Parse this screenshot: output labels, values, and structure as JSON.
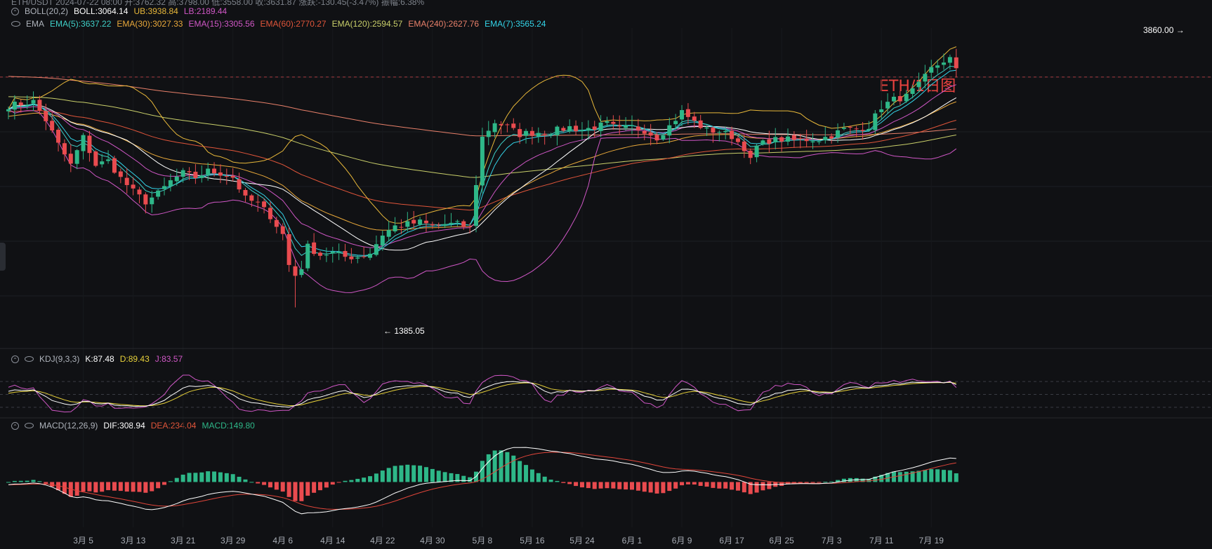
{
  "header_truncated": "ETH/USDT  2024-07-22 08:00  开:3762.32  高:3798.00  低:3558.00  收:3631.87  涨跌:-130.45(-3.47%)  振幅:6.38%",
  "legends": {
    "boll": {
      "name": "BOLL(20,2)",
      "mid": "BOLL:3064.14",
      "ub": "UB:3938.84",
      "lb": "LB:2189.44"
    },
    "ema": {
      "name": "EMA",
      "items": [
        {
          "label": "EMA(5):3637.22",
          "color": "#3fd0c8"
        },
        {
          "label": "EMA(30):3027.33",
          "color": "#e8a83a"
        },
        {
          "label": "EMA(15):3305.56",
          "color": "#d057c6"
        },
        {
          "label": "EMA(60):2770.27",
          "color": "#e0553a"
        },
        {
          "label": "EMA(120):2594.57",
          "color": "#c9cf6a"
        },
        {
          "label": "EMA(240):2627.76",
          "color": "#e8806a"
        },
        {
          "label": "EMA(7):3565.24",
          "color": "#33d4e8"
        }
      ]
    },
    "kdj": {
      "name": "KDJ(9,3,3)",
      "k": "K:87.48",
      "d": "D:89.43",
      "j": "J:83.57"
    },
    "macd": {
      "name": "MACD(12,26,9)",
      "dif": "DIF:308.94",
      "dea": "DEA:234.04",
      "macd": "MACD:149.80"
    }
  },
  "chart_title": "ETH/1日图",
  "high_label": "3860.00",
  "low_label": "1385.05",
  "colors": {
    "up": "#2eb788",
    "down": "#e94b4f",
    "bg": "#101114"
  },
  "chart_data": {
    "type": "candlestick",
    "price_range": [
      1100,
      4120
    ],
    "x_ticks": [
      {
        "label": "3月 5",
        "index": 12
      },
      {
        "label": "3月 13",
        "index": 20
      },
      {
        "label": "3月 21",
        "index": 28
      },
      {
        "label": "3月 29",
        "index": 36
      },
      {
        "label": "4月 6",
        "index": 44
      },
      {
        "label": "4月 14",
        "index": 52
      },
      {
        "label": "4月 22",
        "index": 60
      },
      {
        "label": "4月 30",
        "index": 68
      },
      {
        "label": "5月 8",
        "index": 76
      },
      {
        "label": "5月 16",
        "index": 84
      },
      {
        "label": "5月 24",
        "index": 92
      },
      {
        "label": "6月 1",
        "index": 100
      },
      {
        "label": "6月 9",
        "index": 108
      },
      {
        "label": "6月 17",
        "index": 116
      },
      {
        "label": "6月 25",
        "index": 124
      },
      {
        "label": "7月 3",
        "index": 132
      },
      {
        "label": "7月 11",
        "index": 140
      },
      {
        "label": "7月 19",
        "index": 148
      }
    ],
    "anchors": [
      [
        0,
        3360
      ],
      [
        4,
        3400
      ],
      [
        6,
        3220
      ],
      [
        8,
        2980
      ],
      [
        10,
        2780
      ],
      [
        12,
        3050
      ],
      [
        14,
        2780
      ],
      [
        16,
        2820
      ],
      [
        18,
        2650
      ],
      [
        20,
        2520
      ],
      [
        22,
        2420
      ],
      [
        24,
        2500
      ],
      [
        26,
        2620
      ],
      [
        28,
        2700
      ],
      [
        30,
        2660
      ],
      [
        32,
        2720
      ],
      [
        34,
        2700
      ],
      [
        36,
        2660
      ],
      [
        38,
        2450
      ],
      [
        40,
        2400
      ],
      [
        42,
        2280
      ],
      [
        44,
        2100
      ],
      [
        45,
        1800
      ],
      [
        46,
        1700
      ],
      [
        47,
        1780
      ],
      [
        48,
        1980
      ],
      [
        50,
        1900
      ],
      [
        52,
        1920
      ],
      [
        54,
        1880
      ],
      [
        56,
        1880
      ],
      [
        58,
        1920
      ],
      [
        60,
        2100
      ],
      [
        62,
        2180
      ],
      [
        64,
        2200
      ],
      [
        66,
        2220
      ],
      [
        68,
        2180
      ],
      [
        70,
        2200
      ],
      [
        72,
        2200
      ],
      [
        74,
        2160
      ],
      [
        75,
        2600
      ],
      [
        76,
        3050
      ],
      [
        78,
        3200
      ],
      [
        80,
        3150
      ],
      [
        82,
        3080
      ],
      [
        84,
        3100
      ],
      [
        86,
        3100
      ],
      [
        88,
        3120
      ],
      [
        90,
        3150
      ],
      [
        92,
        3120
      ],
      [
        94,
        3150
      ],
      [
        96,
        3180
      ],
      [
        98,
        3130
      ],
      [
        100,
        3150
      ],
      [
        102,
        3120
      ],
      [
        104,
        3050
      ],
      [
        106,
        3160
      ],
      [
        108,
        3300
      ],
      [
        110,
        3200
      ],
      [
        112,
        3120
      ],
      [
        114,
        3110
      ],
      [
        116,
        3060
      ],
      [
        118,
        2950
      ],
      [
        119,
        2820
      ],
      [
        120,
        2960
      ],
      [
        122,
        3020
      ],
      [
        124,
        3030
      ],
      [
        126,
        3020
      ],
      [
        128,
        3030
      ],
      [
        130,
        3030
      ],
      [
        132,
        3070
      ],
      [
        134,
        3130
      ],
      [
        136,
        3130
      ],
      [
        138,
        3160
      ],
      [
        140,
        3350
      ],
      [
        142,
        3420
      ],
      [
        144,
        3450
      ],
      [
        146,
        3560
      ],
      [
        148,
        3720
      ],
      [
        150,
        3800
      ],
      [
        151,
        3820
      ],
      [
        152,
        3700
      ]
    ],
    "kdj_range": [
      -10,
      110
    ],
    "macd_range": [
      -350,
      420
    ]
  }
}
